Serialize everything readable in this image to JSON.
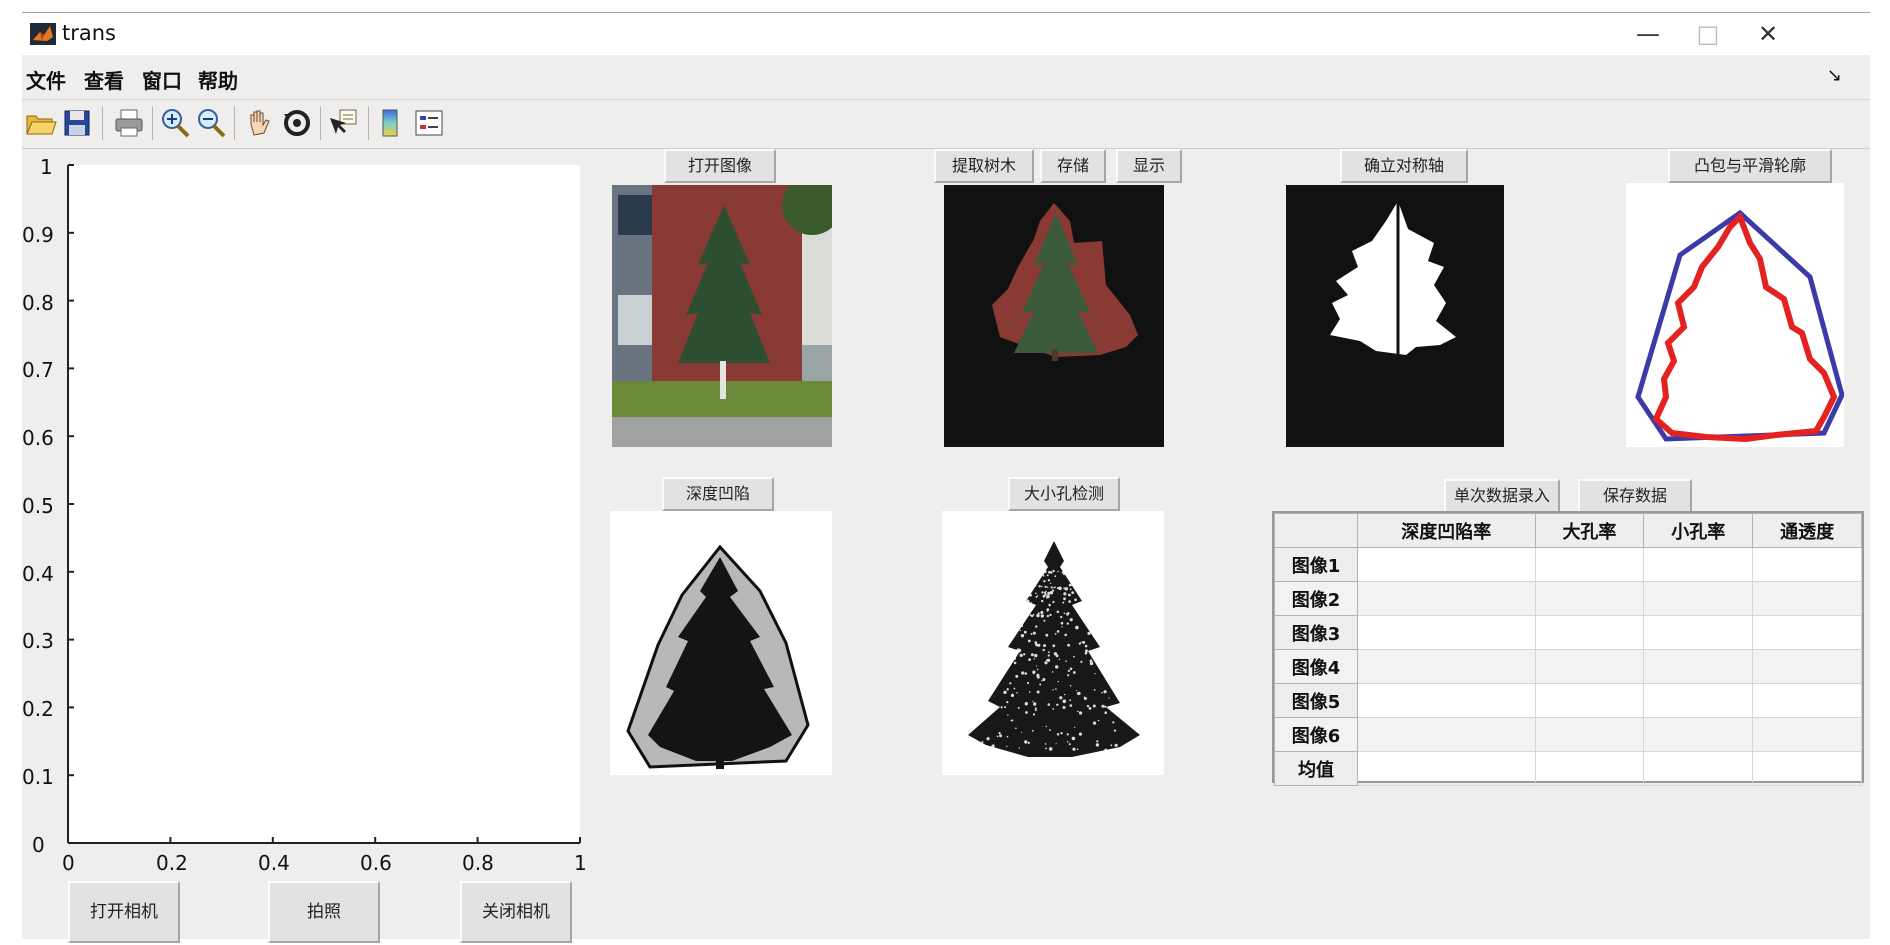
{
  "window": {
    "title": "trans",
    "minimize": "—",
    "maximize": "□",
    "close": "✕"
  },
  "menu": [
    "文件",
    "查看",
    "窗口",
    "帮助"
  ],
  "toolbar": [
    "open-icon",
    "save-icon",
    "print-icon",
    "zoom-in-icon",
    "zoom-out-icon",
    "pan-icon",
    "rotate-icon",
    "data-cursor-icon",
    "colorbar-icon",
    "legend-icon"
  ],
  "axes": {
    "y_ticks": [
      "0",
      "0.1",
      "0.2",
      "0.3",
      "0.4",
      "0.5",
      "0.6",
      "0.7",
      "0.8",
      "0.9",
      "1"
    ],
    "x_ticks": [
      "0",
      "0.2",
      "0.4",
      "0.6",
      "0.8",
      "1"
    ]
  },
  "buttons": {
    "open_camera": "打开相机",
    "take_photo": "拍照",
    "close_camera": "关闭相机",
    "open_image": "打开图像",
    "extract_tree": "提取树木",
    "store": "存储",
    "show": "显示",
    "symmetry_axis": "确立对称轴",
    "convex_hull": "凸包与平滑轮廓",
    "depth_dent": "深度凹陷",
    "hole_detect": "大小孔检测",
    "single_entry": "单次数据录入",
    "save_data": "保存数据"
  },
  "table": {
    "columns": [
      "",
      "深度凹陷率",
      "大孔率",
      "小孔率",
      "通透度"
    ],
    "rows": [
      "图像1",
      "图像2",
      "图像3",
      "图像4",
      "图像5",
      "图像6",
      "均值"
    ]
  },
  "colors": {
    "hull_blue": "#3a3aa8",
    "contour_red": "#e52222"
  }
}
